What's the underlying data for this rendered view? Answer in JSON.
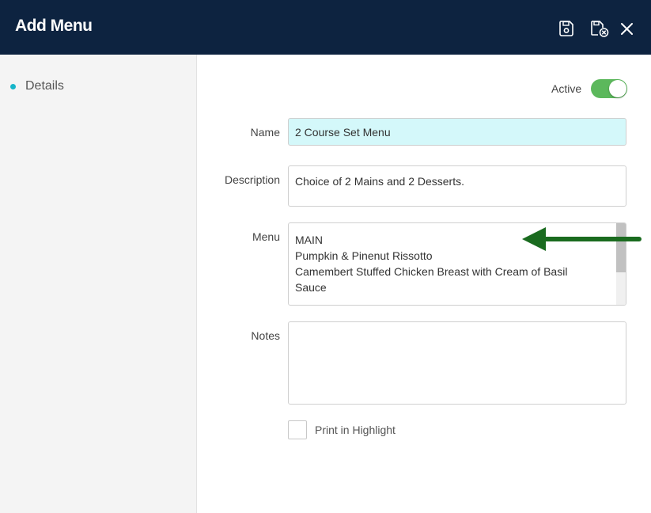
{
  "header": {
    "title": "Add Menu",
    "icons": [
      "save-icon",
      "save-close-icon",
      "close-icon"
    ]
  },
  "sidebar": {
    "items": [
      {
        "label": "Details",
        "icon": "bullet-dot"
      }
    ]
  },
  "form": {
    "active_label": "Active",
    "active_on": true,
    "name_label": "Name",
    "name_value": "2 Course Set Menu",
    "description_label": "Description",
    "description_value": "Choice of 2 Mains and 2 Desserts.",
    "menu_label": "Menu",
    "menu_lines": [
      "MAIN",
      "Pumpkin & Pinenut Rissotto",
      "Camembert Stuffed Chicken Breast with Cream of Basil",
      "Sauce"
    ],
    "notes_label": "Notes",
    "notes_value": "",
    "print_label": "Print in Highlight",
    "print_checked": false
  },
  "colors": {
    "header_bg": "#0d2340",
    "accent": "#16b5c9",
    "toggle_on": "#5cb85c",
    "name_field_bg": "#d4f8fa",
    "annotation_arrow": "#1a6b1f"
  }
}
